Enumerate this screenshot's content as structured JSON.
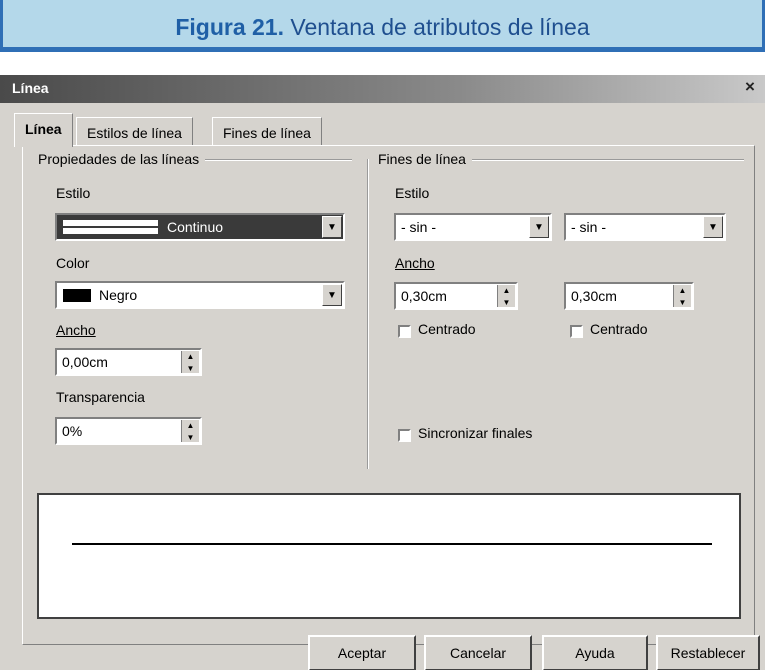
{
  "caption": {
    "figure": "Figura 21.",
    "text": "Ventana de atributos de línea"
  },
  "dialog": {
    "title": "Línea",
    "close": "×",
    "tabs": [
      "Línea",
      "Estilos de línea",
      "Fines de línea"
    ],
    "properties": {
      "heading": "Propiedades de las líneas",
      "style_label": "Estilo",
      "style_value": "Continuo",
      "color_label": "Color",
      "color_value": "Negro",
      "color_swatch": "#000000",
      "width_label": "Ancho",
      "width_value": "0,00cm",
      "transparency_label": "Transparencia",
      "transparency_value": "0%"
    },
    "line_ends": {
      "heading": "Fines de línea",
      "style_label": "Estilo",
      "start_style": "- sin -",
      "end_style": "- sin -",
      "width_label": "Ancho",
      "start_width": "0,30cm",
      "end_width": "0,30cm",
      "centered_label_start": "Centrado",
      "centered_label_end": "Centrado",
      "sync_label": "Sincronizar finales"
    },
    "buttons": {
      "ok": "Aceptar",
      "cancel": "Cancelar",
      "help": "Ayuda",
      "reset": "Restablecer"
    }
  }
}
